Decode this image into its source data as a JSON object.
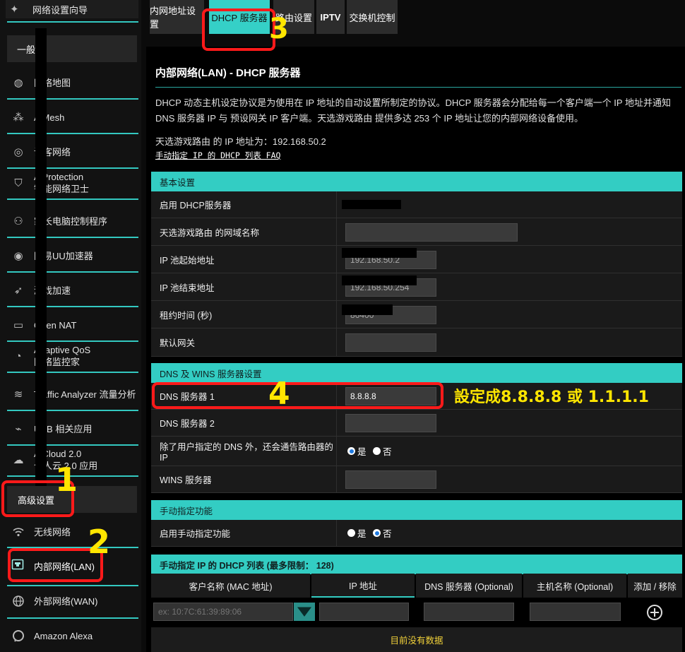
{
  "sidebar": {
    "wizard": "网络设置向导",
    "general_header": "一般",
    "items": [
      {
        "label": "网络地图",
        "icon": "globe-icon"
      },
      {
        "label": "AiMesh",
        "icon": "mesh-icon"
      },
      {
        "label": "访客网络",
        "icon": "guest-network-icon"
      },
      {
        "label": "AiProtection\n智能网络卫士",
        "icon": "shield-icon"
      },
      {
        "label": "家长电脑控制程序",
        "icon": "family-icon"
      },
      {
        "label": "网易UU加速器",
        "icon": "accelerator-icon"
      },
      {
        "label": "游戏加速",
        "icon": "rocket-icon"
      },
      {
        "label": "Open NAT",
        "icon": "nat-icon"
      },
      {
        "label": "Adaptive QoS\n网络监控家",
        "icon": "gauge-icon"
      },
      {
        "label": "Traffic Analyzer 流量分析",
        "icon": "traffic-icon"
      },
      {
        "label": "USB 相关应用",
        "icon": "usb-icon"
      },
      {
        "label": "AiCloud 2.0\n个人云 2.0 应用",
        "icon": "cloud-icon"
      }
    ],
    "advanced_header": "高级设置",
    "adv_items": [
      {
        "label": "无线网络",
        "icon": "wifi-icon"
      },
      {
        "label": "内部网络(LAN)",
        "icon": "lan-icon"
      },
      {
        "label": "外部网络(WAN)",
        "icon": "wan-globe-icon"
      },
      {
        "label": "Amazon Alexa",
        "icon": "alexa-icon"
      }
    ]
  },
  "tabs": [
    "内网地址设置",
    "DHCP 服务器",
    "路由设置",
    "IPTV",
    "交换机控制"
  ],
  "page": {
    "title": "内部网络(LAN) - DHCP 服务器",
    "desc": "DHCP 动态主机设定协议是为使用在 IP 地址的自动设置所制定的协议。DHCP 服务器会分配给每一个客户端一个 IP 地址并通知 DNS 服务器 IP 与 预设网关 IP 客户端。天选游戏路由 提供多达 253 个 IP 地址让您的内部网络设备使用。",
    "ip_line": "天选游戏路由 的 IP 地址为：192.168.50.2",
    "faq": "手动指定 IP 的 DHCP 列表 FAQ"
  },
  "basic": {
    "header": "基本设置",
    "rows": [
      {
        "label": "启用 DHCP服务器"
      },
      {
        "label": "天选游戏路由 的网域名称",
        "value": ""
      },
      {
        "label": "IP 池起始地址",
        "value": "192.168.50.2"
      },
      {
        "label": "IP 池结束地址",
        "value": "192.168.50.254"
      },
      {
        "label": "租约时间 (秒)",
        "value": "86400"
      },
      {
        "label": "默认网关",
        "value": ""
      }
    ]
  },
  "dns": {
    "header": "DNS 及 WINS 服务器设置",
    "dns1_label": "DNS 服务器 1",
    "dns1_value": "8.8.8.8",
    "dns2_label": "DNS 服务器 2",
    "dns2_value": "",
    "advertise_label": "除了用户指定的 DNS 外，还会通告路由器的 IP",
    "yes": "是",
    "no": "否",
    "wins_label": "WINS 服务器",
    "wins_value": ""
  },
  "manual": {
    "header": "手动指定功能",
    "enable_label": "启用手动指定功能",
    "yes": "是",
    "no": "否"
  },
  "list": {
    "header": "手动指定 IP 的 DHCP 列表 (最多限制： 128)",
    "columns": [
      "客户名称 (MAC 地址)",
      "IP 地址",
      "DNS 服务器 (Optional)",
      "主机名称 (Optional)",
      "添加 / 移除"
    ],
    "mac_placeholder": "ex: 10:7C:61:39:89:06",
    "empty": "目前没有数据"
  },
  "annotations": {
    "n1": "1",
    "n2": "2",
    "n3": "3",
    "n4": "4",
    "note": "設定成8.8.8.8 或 1.1.1.1"
  },
  "colors": {
    "accent": "#33cdc3",
    "annotation_red": "#ff1a1a",
    "annotation_yellow": "#ffe600"
  }
}
